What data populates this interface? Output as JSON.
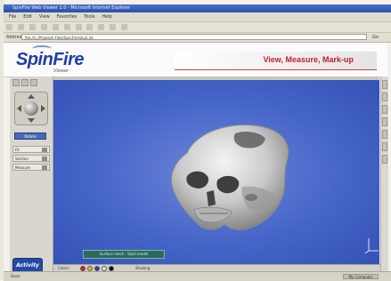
{
  "window": {
    "title": "SpinFire Web Viewer 1.0 - Microsoft Internet Explorer",
    "menu": [
      "File",
      "Edit",
      "View",
      "Favorites",
      "Tools",
      "Help"
    ]
  },
  "address": {
    "label": "Address",
    "value": "file://C:/Program Files/SpinFire/skull.3d",
    "go_label": "Go"
  },
  "brand": {
    "logo_text": "SpinFire",
    "logo_tagline": "Viewer",
    "banner": "View, Measure, Mark-up"
  },
  "left_panel": {
    "mode_button": "Rotate",
    "rows": [
      "Fit",
      "Section",
      "Measure"
    ],
    "activity_button": "Activity"
  },
  "viewport": {
    "status_tag": "Surface mesh - Skull model",
    "model": "skull"
  },
  "bottom_bar": {
    "colors_label": "Colors",
    "swatches": [
      "#d22020",
      "#d4c21a",
      "#2a3fc0",
      "#e6e6e6",
      "#111111"
    ],
    "extra_label": "Shading"
  },
  "status": {
    "left": "Done",
    "right": "My Computer"
  },
  "colors": {
    "accent": "#1d3fa8",
    "banner_text": "#c0202c",
    "viewport_bg": "#4565c9"
  }
}
